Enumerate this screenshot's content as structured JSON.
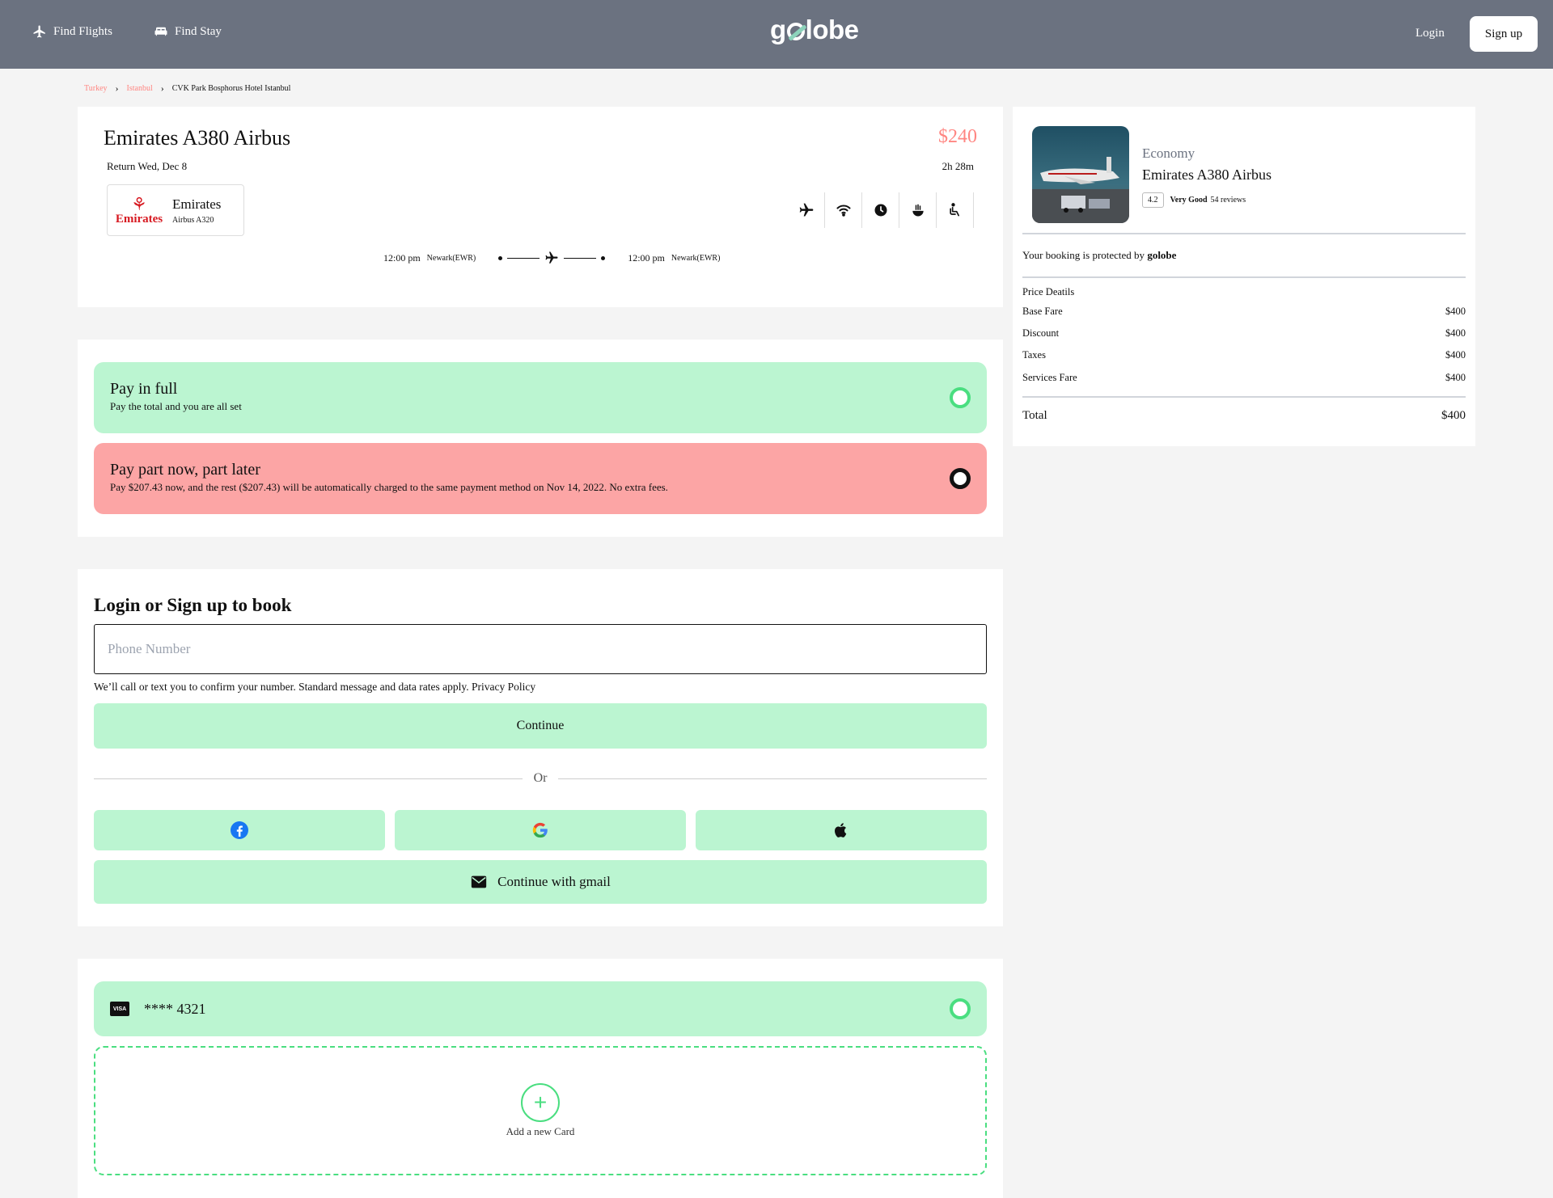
{
  "header": {
    "nav": [
      {
        "label": "Find Flights",
        "icon": "airplane-icon"
      },
      {
        "label": "Find Stay",
        "icon": "bed-icon"
      }
    ],
    "logo_prefix": "g",
    "logo_suffix": "lobe",
    "login_label": "Login",
    "signup_label": "Sign up"
  },
  "breadcrumb": [
    "Turkey",
    "Istanbul",
    "CVK Park Bosphorus Hotel Istanbul"
  ],
  "flight": {
    "title": "Emirates A380 Airbus",
    "price": "$240",
    "return_label": "Return Wed, Dec 8",
    "duration": "2h 28m",
    "airline_name": "Emirates",
    "airline_model": "Airbus A320",
    "airline_logo_text": "Emirates",
    "amenities": [
      "airplane-icon",
      "wifi-icon",
      "clock-icon",
      "food-icon",
      "seat-icon"
    ],
    "depart_time": "12:00 pm",
    "depart_airport": "Newark(EWR)",
    "arrive_time": "12:00 pm",
    "arrive_airport": "Newark(EWR)"
  },
  "payment": {
    "full_title": "Pay in full",
    "full_desc": "Pay the total and you are all set",
    "part_title": "Pay part now, part later",
    "part_desc": "Pay $207.43 now, and the rest ($207.43) will be automatically charged to the same payment method on Nov 14, 2022. No extra fees."
  },
  "login": {
    "title": "Login or Sign up to book",
    "phone_placeholder": "Phone Number",
    "note": "We’ll call or text you to confirm your number. Standard message and data rates apply. Privacy Policy",
    "continue_label": "Continue",
    "or_label": "Or",
    "social": [
      "facebook-icon",
      "google-icon",
      "apple-icon"
    ],
    "gmail_label": "Continue with gmail"
  },
  "cards": {
    "saved_card": "**** 4321",
    "card_brand": "VISA",
    "add_label": "Add a new Card"
  },
  "summary": {
    "class_label": "Economy",
    "title": "Emirates A380 Airbus",
    "score": "4.2",
    "rating_label": "Very Good",
    "reviews": "54 reviews",
    "protected_prefix": "Your booking is protected by",
    "protected_brand": "golobe",
    "price_details_label": "Price Deatils",
    "rows": [
      {
        "label": "Base Fare",
        "value": "$400"
      },
      {
        "label": "Discount",
        "value": "$400"
      },
      {
        "label": "Taxes",
        "value": "$400"
      },
      {
        "label": "Services Fare",
        "value": "$400"
      }
    ],
    "total_label": "Total",
    "total_value": "$400"
  },
  "colors": {
    "header_bg": "#6b7280",
    "mint": "#bbf5d1",
    "salmon": "#fca5a5",
    "accent_green": "#4ade80",
    "price_pink": "#ff8682"
  }
}
